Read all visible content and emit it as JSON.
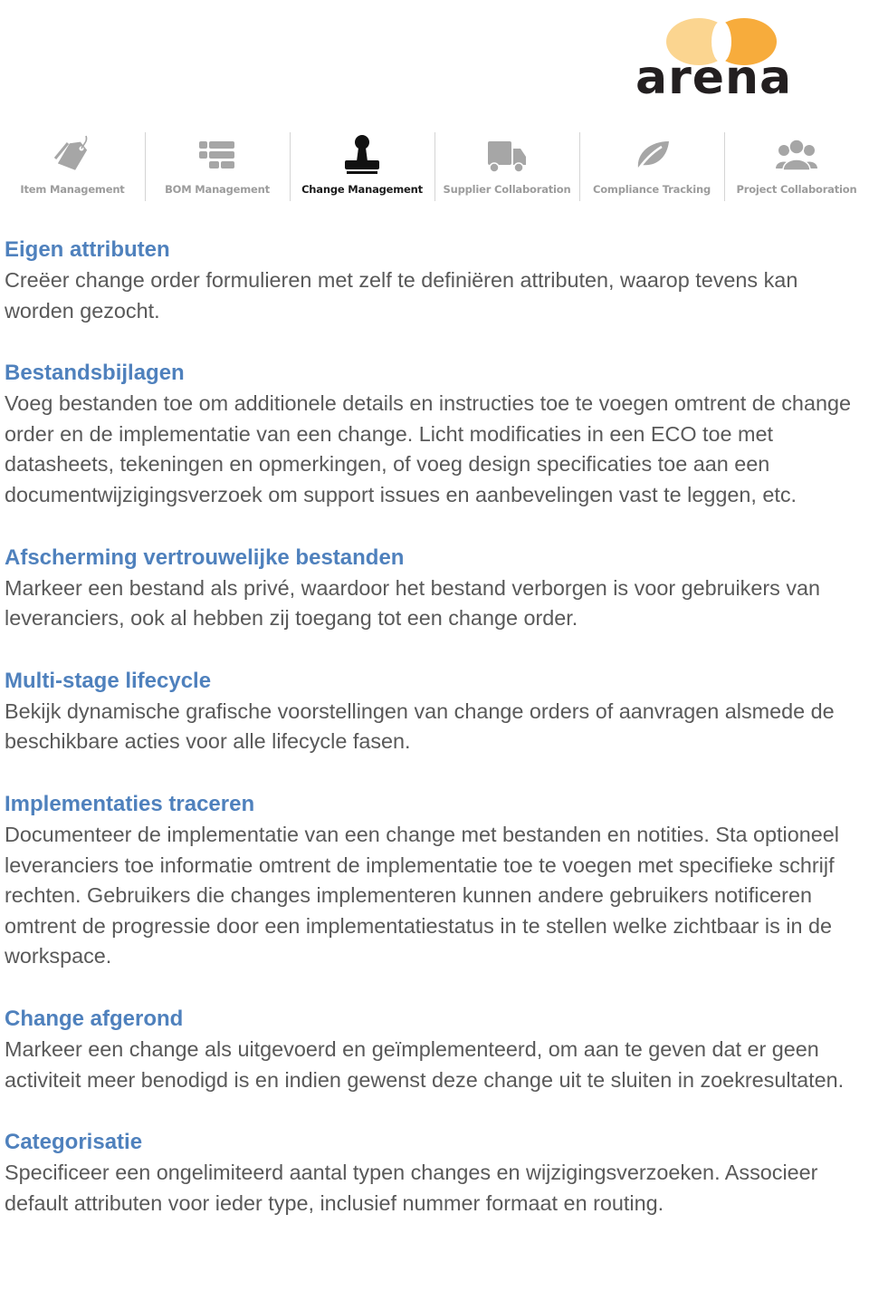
{
  "brand": {
    "name": "arena",
    "colors": {
      "circle_left": "#fbd590",
      "circle_right": "#f7ac3c",
      "wordmark": "#231f20"
    }
  },
  "nav": {
    "items": [
      {
        "label": "Item Management",
        "icon": "tag-icon",
        "active": false
      },
      {
        "label": "BOM Management",
        "icon": "bom-list-icon",
        "active": false
      },
      {
        "label": "Change Management",
        "icon": "stamp-icon",
        "active": true
      },
      {
        "label": "Supplier Collaboration",
        "icon": "truck-icon",
        "active": false
      },
      {
        "label": "Compliance Tracking",
        "icon": "leaf-icon",
        "active": false
      },
      {
        "label": "Project Collaboration",
        "icon": "users-icon",
        "active": false
      }
    ],
    "colors": {
      "inactive": "#9c9c9c",
      "active": "#1a1a1a"
    }
  },
  "sections": [
    {
      "title": "Eigen attributen",
      "body": "Creëer change order formulieren met zelf te definiëren attributen, waarop tevens kan worden gezocht."
    },
    {
      "title": "Bestandsbijlagen",
      "body": "Voeg bestanden toe om additionele details en instructies toe te voegen omtrent de change order en de implementatie van een change. Licht modificaties in een ECO toe met datasheets, tekeningen en opmerkingen, of voeg design specificaties toe aan een documentwijzigingsverzoek om support issues en aanbevelingen vast te leggen, etc."
    },
    {
      "title": "Afscherming vertrouwelijke bestanden",
      "body": "Markeer een bestand als privé, waardoor het bestand verborgen is voor gebruikers van leveranciers, ook al hebben zij toegang tot een change order."
    },
    {
      "title": "Multi-stage lifecycle",
      "body": "Bekijk dynamische grafische voorstellingen van change orders of aanvragen alsmede de beschikbare acties voor alle lifecycle fasen."
    },
    {
      "title": "Implementaties traceren",
      "body": "Documenteer de implementatie van een change met bestanden en notities. Sta optioneel leveranciers toe informatie omtrent de implementatie toe te voegen met specifieke schrijf rechten. Gebruikers die changes implementeren kunnen andere gebruikers notificeren omtrent de progressie door een implementatiestatus in te stellen welke zichtbaar is in de workspace."
    },
    {
      "title": "Change afgerond",
      "body": "Markeer een change als uitgevoerd en geïmplementeerd, om aan te geven dat er geen activiteit meer benodigd is en indien gewenst deze change uit te sluiten in zoekresultaten."
    },
    {
      "title": "Categorisatie",
      "body": "Specificeer een ongelimiteerd aantal typen changes en wijzigingsverzoeken. Associeer default attributen voor ieder type, inclusief nummer formaat en routing."
    }
  ],
  "colors": {
    "heading": "#4f81bd",
    "body_text": "#595959"
  }
}
